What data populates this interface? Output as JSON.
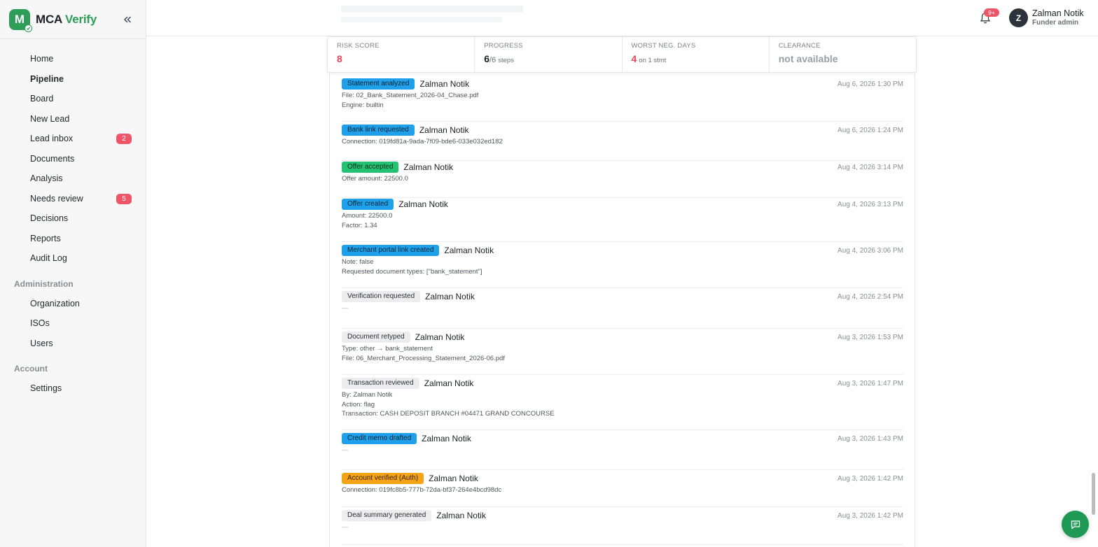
{
  "brand": {
    "logo_letter": "M",
    "name_part1": "MCA",
    "name_part2": "Verify"
  },
  "nav": {
    "items": [
      {
        "label": "Home",
        "icon": "home-icon"
      },
      {
        "label": "Pipeline",
        "icon": "pipeline-icon",
        "active": true
      },
      {
        "label": "Board",
        "icon": "board-icon"
      },
      {
        "label": "New Lead",
        "icon": "plus-icon"
      },
      {
        "label": "Lead inbox",
        "icon": "mail-icon",
        "badge": "2"
      },
      {
        "label": "Documents",
        "icon": "document-icon"
      },
      {
        "label": "Analysis",
        "icon": "bar-chart-icon"
      },
      {
        "label": "Needs review",
        "icon": "warning-icon",
        "badge": "5"
      },
      {
        "label": "Decisions",
        "icon": "check-circle-icon"
      },
      {
        "label": "Reports",
        "icon": "pie-chart-icon"
      },
      {
        "label": "Audit Log",
        "icon": "clipboard-icon"
      }
    ],
    "admin_section": "Administration",
    "admin_items": [
      {
        "label": "Organization",
        "icon": "briefcase-icon"
      },
      {
        "label": "ISOs",
        "icon": "users-icon"
      },
      {
        "label": "Users",
        "icon": "user-icon"
      }
    ],
    "account_section": "Account",
    "account_items": [
      {
        "label": "Settings",
        "icon": "gear-icon"
      }
    ]
  },
  "topbar": {
    "notification_badge": "9+",
    "user_initial": "Z",
    "user_name": "Zalman Notik",
    "user_role": "Funder admin"
  },
  "stats": {
    "risk_label": "RISK SCORE",
    "risk_value": "8",
    "progress_label": "PROGRESS",
    "progress_value": "6",
    "progress_total": "/6",
    "progress_unit": "steps",
    "neg_label": "WORST NEG. DAYS",
    "neg_value": "4",
    "neg_unit": "on 1 stmt",
    "clearance_label": "CLEARANCE",
    "clearance_value": "not available"
  },
  "events": [
    {
      "tag": "Statement analyzed",
      "color": "blue",
      "actor": "Zalman Notik",
      "time": "Aug 6, 2026 1:30 PM",
      "details": [
        "File: 02_Bank_Statement_2026-04_Chase.pdf",
        "Engine: builtin"
      ]
    },
    {
      "tag": "Bank link requested",
      "color": "blue",
      "actor": "Zalman Notik",
      "time": "Aug 6, 2026 1:24 PM",
      "details": [
        "Connection: 019fd81a-9ada-7f09-bde6-033e032ed182"
      ]
    },
    {
      "tag": "Offer accepted",
      "color": "green",
      "actor": "Zalman Notik",
      "time": "Aug 4, 2026 3:14 PM",
      "details": [
        "Offer amount: 22500.0"
      ]
    },
    {
      "tag": "Offer created",
      "color": "blue",
      "actor": "Zalman Notik",
      "time": "Aug 4, 2026 3:13 PM",
      "details": [
        "Amount: 22500.0",
        "Factor: 1.34"
      ]
    },
    {
      "tag": "Merchant portal link created",
      "color": "blue",
      "actor": "Zalman Notik",
      "time": "Aug 4, 2026 3:06 PM",
      "details": [
        "Note: false",
        "Requested document types: [\"bank_statement\"]"
      ]
    },
    {
      "tag": "Verification requested",
      "color": "gray",
      "actor": "Zalman Notik",
      "time": "Aug 4, 2026 2:54 PM",
      "details": [
        "—"
      ]
    },
    {
      "tag": "Document retyped",
      "color": "gray",
      "actor": "Zalman Notik",
      "time": "Aug 3, 2026 1:53 PM",
      "details": [
        "Type: other → bank_statement",
        "File: 06_Merchant_Processing_Statement_2026-06.pdf"
      ]
    },
    {
      "tag": "Transaction reviewed",
      "color": "gray",
      "actor": "Zalman Notik",
      "time": "Aug 3, 2026 1:47 PM",
      "details": [
        "By: Zalman Notik",
        "Action: flag",
        "Transaction: CASH DEPOSIT BRANCH #04471 GRAND CONCOURSE"
      ]
    },
    {
      "tag": "Credit memo drafted",
      "color": "blue",
      "actor": "Zalman Notik",
      "time": "Aug 3, 2026 1:43 PM",
      "details": [
        "—"
      ]
    },
    {
      "tag": "Account verified (Auth)",
      "color": "orange",
      "actor": "Zalman Notik",
      "time": "Aug 3, 2026 1:42 PM",
      "details": [
        "Connection: 019fc8b5-777b-72da-bf37-264e4bcd98dc"
      ]
    },
    {
      "tag": "Deal summary generated",
      "color": "gray",
      "actor": "Zalman Notik",
      "time": "Aug 3, 2026 1:42 PM",
      "details": [
        "—"
      ]
    }
  ]
}
